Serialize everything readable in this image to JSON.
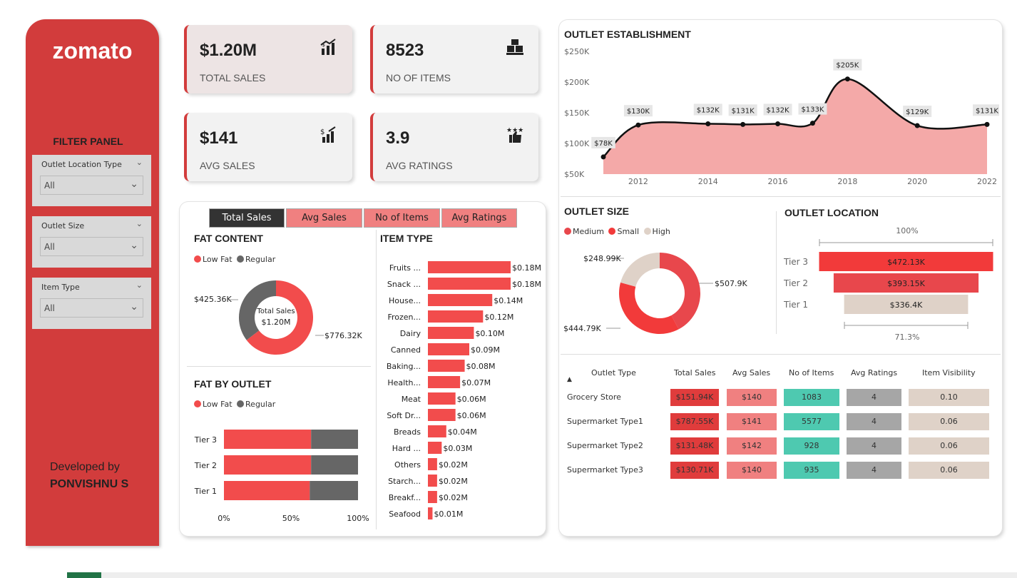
{
  "brand": {
    "logo": "zomato",
    "color": "#d23c3c"
  },
  "filter_panel": {
    "title": "FILTER PANEL",
    "slicers": [
      {
        "label": "Outlet Location Type",
        "value": "All"
      },
      {
        "label": "Outlet Size",
        "value": "All"
      },
      {
        "label": "Item Type",
        "value": "All"
      }
    ]
  },
  "developer": {
    "line1": "Developed by",
    "name": "PONVISHNU S"
  },
  "kpis": [
    {
      "value": "$1.20M",
      "label": "TOTAL SALES",
      "icon": "chart-up-icon"
    },
    {
      "value": "8523",
      "label": "NO OF ITEMS",
      "icon": "boxes-icon"
    },
    {
      "value": "$141",
      "label": "AVG SALES",
      "icon": "dollar-bar-icon"
    },
    {
      "value": "3.9",
      "label": "AVG RATINGS",
      "icon": "thumbs-stars-icon"
    }
  ],
  "tabs": [
    "Total Sales",
    "Avg Sales",
    "No of Items",
    "Avg Ratings"
  ],
  "fat_content": {
    "title": "FAT CONTENT",
    "legend": [
      "Low Fat",
      "Regular"
    ],
    "center_label": "Total Sales",
    "center_value": "$1.20M",
    "labels": {
      "low_fat": "$776.32K",
      "regular": "$425.36K"
    }
  },
  "fat_by_outlet": {
    "title": "FAT BY OUTLET",
    "legend": [
      "Low Fat",
      "Regular"
    ]
  },
  "item_type": {
    "title": "ITEM TYPE"
  },
  "outlet_establishment": {
    "title": "OUTLET ESTABLISHMENT"
  },
  "outlet_size": {
    "title": "OUTLET SIZE",
    "legend": [
      "Medium",
      "Small",
      "High"
    ]
  },
  "outlet_location": {
    "title": "OUTLET LOCATION",
    "top_label": "100%",
    "bottom_label": "71.3%"
  },
  "table": {
    "headers": [
      "Outlet Type",
      "Total Sales",
      "Avg Sales",
      "No of Items",
      "Avg Ratings",
      "Item Visibility"
    ],
    "rows": [
      [
        "Grocery Store",
        "$151.94K",
        "$140",
        "1083",
        "4",
        "0.10"
      ],
      [
        "Supermarket Type1",
        "$787.55K",
        "$141",
        "5577",
        "4",
        "0.06"
      ],
      [
        "Supermarket Type2",
        "$131.48K",
        "$142",
        "928",
        "4",
        "0.06"
      ],
      [
        "Supermarket Type3",
        "$130.71K",
        "$140",
        "935",
        "4",
        "0.06"
      ]
    ]
  },
  "colors": {
    "red": "#f24c4c",
    "grey": "#666666",
    "pink": "#f4a9a8",
    "beige": "#dfd2c8",
    "teal": "#4ec9b0"
  },
  "chart_data": [
    {
      "type": "line",
      "title": "OUTLET ESTABLISHMENT",
      "x": [
        2011,
        2012,
        2014,
        2015,
        2016,
        2017,
        2018,
        2020,
        2022
      ],
      "values": [
        78,
        130,
        132,
        131,
        132,
        133,
        205,
        129,
        131
      ],
      "labels": [
        "$78K",
        "$130K",
        "$132K",
        "$131K",
        "$132K",
        "$133K",
        "$205K",
        "$129K",
        "$131K"
      ],
      "x_ticks": [
        "2012",
        "2014",
        "2016",
        "2018",
        "2020",
        "2022"
      ],
      "y_ticks": [
        "$50K",
        "$100K",
        "$150K",
        "$200K",
        "$250K"
      ],
      "ylim": [
        50,
        250
      ],
      "xlim": [
        2011,
        2022
      ]
    },
    {
      "type": "bar",
      "title": "ITEM TYPE",
      "categories": [
        "Fruits ...",
        "Snack ...",
        "House...",
        "Frozen...",
        "Dairy",
        "Canned",
        "Baking...",
        "Health...",
        "Meat",
        "Soft Dr...",
        "Breads",
        "Hard ...",
        "Others",
        "Starch...",
        "Breakf...",
        "Seafood"
      ],
      "values": [
        0.18,
        0.18,
        0.14,
        0.12,
        0.1,
        0.09,
        0.08,
        0.07,
        0.06,
        0.06,
        0.04,
        0.03,
        0.02,
        0.02,
        0.02,
        0.01
      ],
      "labels": [
        "$0.18M",
        "$0.18M",
        "$0.14M",
        "$0.12M",
        "$0.10M",
        "$0.09M",
        "$0.08M",
        "$0.07M",
        "$0.06M",
        "$0.06M",
        "$0.04M",
        "$0.03M",
        "$0.02M",
        "$0.02M",
        "$0.02M",
        "$0.01M"
      ]
    },
    {
      "type": "pie",
      "title": "FAT CONTENT",
      "categories": [
        "Low Fat",
        "Regular"
      ],
      "values": [
        776.32,
        425.36
      ]
    },
    {
      "type": "bar",
      "title": "FAT BY OUTLET",
      "categories": [
        "Tier 3",
        "Tier 2",
        "Tier 1"
      ],
      "series": [
        {
          "name": "Low Fat",
          "values": [
            65,
            65,
            64
          ]
        },
        {
          "name": "Regular",
          "values": [
            35,
            35,
            36
          ]
        }
      ],
      "x_ticks": [
        "0%",
        "50%",
        "100%"
      ],
      "xlim": [
        0,
        100
      ]
    },
    {
      "type": "pie",
      "title": "OUTLET SIZE",
      "categories": [
        "Medium",
        "Small",
        "High"
      ],
      "values": [
        507.9,
        444.79,
        248.99
      ],
      "labels": [
        "$507.9K",
        "$444.79K",
        "$248.99K"
      ]
    },
    {
      "type": "bar",
      "title": "OUTLET LOCATION",
      "categories": [
        "Tier 3",
        "Tier 2",
        "Tier 1"
      ],
      "values": [
        472.13,
        393.15,
        336.4
      ],
      "labels": [
        "$472.13K",
        "$393.15K",
        "$336.4K"
      ]
    }
  ]
}
